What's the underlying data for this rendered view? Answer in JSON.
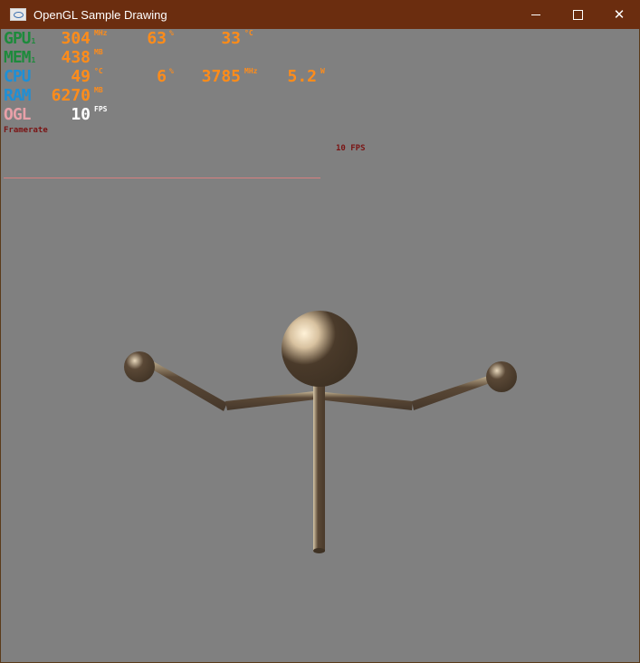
{
  "window": {
    "title": "OpenGL Sample Drawing",
    "minimize": "",
    "maximize": "",
    "close": "✕"
  },
  "osd": {
    "gpu": {
      "label": "GPU",
      "sub": "1",
      "clock": "304",
      "clock_unit": "MHz",
      "load": "63",
      "load_unit": "%",
      "temp": "33",
      "temp_unit": "°C"
    },
    "mem": {
      "label": "MEM",
      "sub": "1",
      "value": "438",
      "unit": "MB"
    },
    "cpu": {
      "label": "CPU",
      "temp": "49",
      "temp_unit": "°C",
      "load": "6",
      "load_unit": "%",
      "clock": "3785",
      "clock_unit": "MHz",
      "power": "5.2",
      "power_unit": "W"
    },
    "ram": {
      "label": "RAM",
      "value": "6270",
      "unit": "MB"
    },
    "ogl": {
      "label": "OGL",
      "fps": "10",
      "fps_unit": "FPS"
    },
    "framerate_label": "Framerate",
    "graph_label": "10 FPS"
  },
  "colors": {
    "titlebar": "#6b2d0f",
    "background": "#808080",
    "gpu_label": "#1e8a3c",
    "mem_label": "#1e8a3c",
    "cpu_label": "#1e8fd6",
    "ram_label": "#1e8fd6",
    "ogl_label": "#e8a0a8",
    "value": "#ff8c1a",
    "fps_value": "#ffffff",
    "figure": "#4a3a2a"
  }
}
